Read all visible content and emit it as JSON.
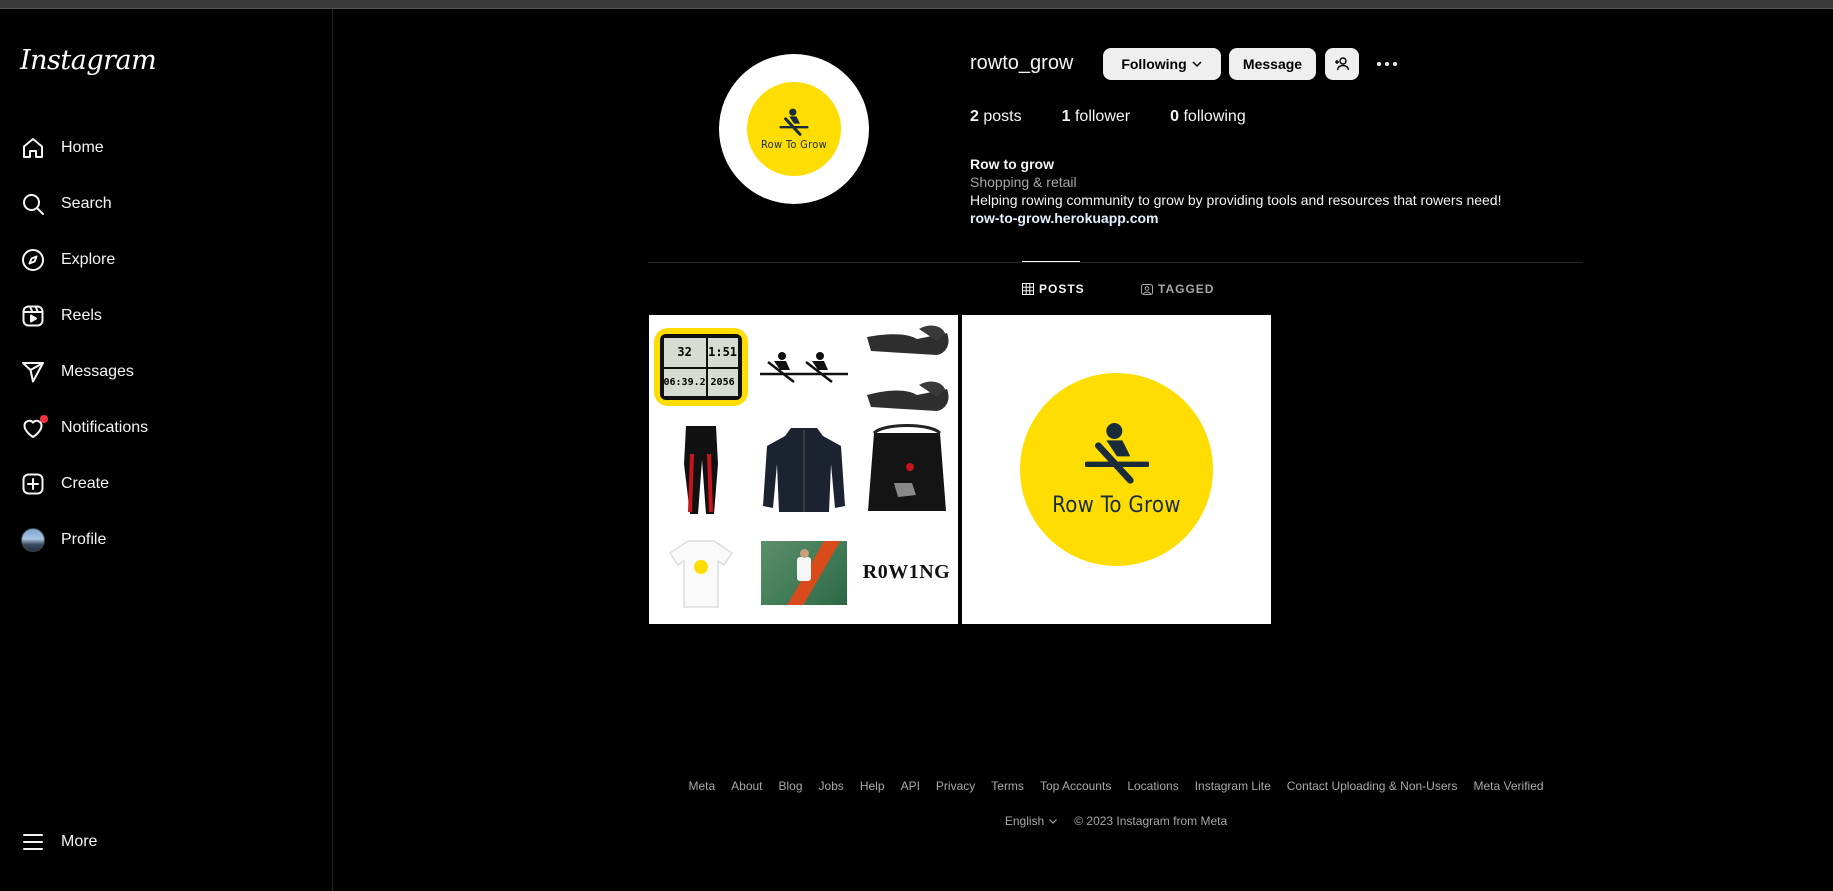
{
  "app": {
    "logo_text": "Instagram"
  },
  "sidebar": {
    "items": [
      {
        "label": "Home",
        "icon": "home-icon"
      },
      {
        "label": "Search",
        "icon": "search-icon"
      },
      {
        "label": "Explore",
        "icon": "compass-icon"
      },
      {
        "label": "Reels",
        "icon": "reels-icon"
      },
      {
        "label": "Messages",
        "icon": "send-icon"
      },
      {
        "label": "Notifications",
        "icon": "heart-icon"
      },
      {
        "label": "Create",
        "icon": "plus-square-icon"
      },
      {
        "label": "Profile",
        "icon": "avatar"
      }
    ],
    "more_label": "More"
  },
  "profile": {
    "username": "rowto_grow",
    "following_button": "Following",
    "message_button": "Message",
    "stats": {
      "posts_count": "2",
      "posts_label": "posts",
      "followers_count": "1",
      "followers_label": "follower",
      "following_count": "0",
      "following_label": "following"
    },
    "bio": {
      "name": "Row to grow",
      "category": "Shopping & retail",
      "text": "Helping rowing community to grow by providing tools and resources that rowers need!",
      "link": "row-to-grow.herokuapp.com"
    },
    "avatar_brand": "Row To Grow"
  },
  "tabs": [
    {
      "label": "POSTS",
      "icon": "grid-icon",
      "active": true
    },
    {
      "label": "TAGGED",
      "icon": "tagged-icon",
      "active": false
    }
  ],
  "posts": {
    "post1": {
      "garmin_values": [
        "32",
        "1:51",
        "06:39.2",
        "2056"
      ],
      "rowing_word": "R0W1NG"
    },
    "post2": {
      "brand": "Row To Grow"
    }
  },
  "footer": {
    "links": [
      "Meta",
      "About",
      "Blog",
      "Jobs",
      "Help",
      "API",
      "Privacy",
      "Terms",
      "Top Accounts",
      "Locations",
      "Instagram Lite",
      "Contact Uploading & Non-Users",
      "Meta Verified"
    ],
    "language": "English",
    "copyright": "© 2023 Instagram from Meta"
  },
  "colors": {
    "brand_yellow": "#ffdd00",
    "notification_dot": "#ff3040",
    "background": "#000000"
  }
}
